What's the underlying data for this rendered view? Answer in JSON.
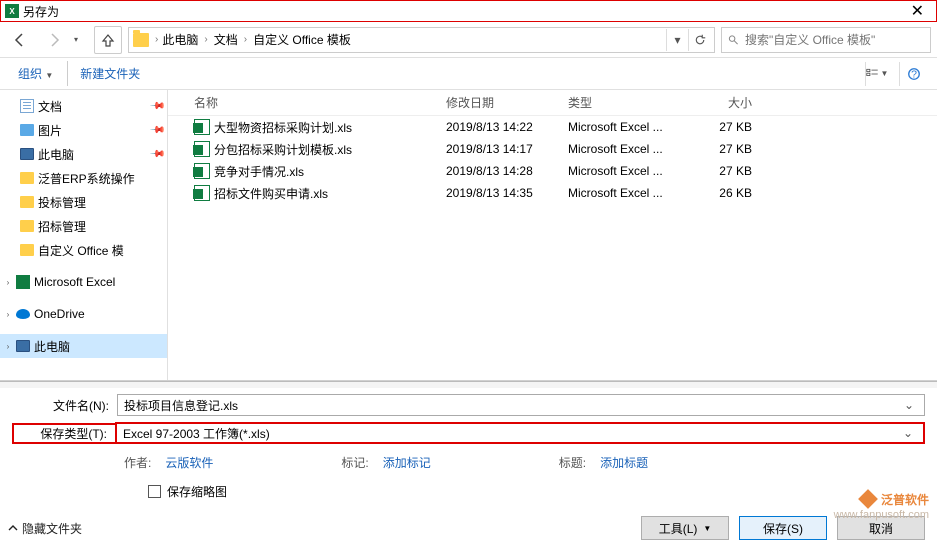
{
  "window": {
    "title": "另存为"
  },
  "nav": {
    "crumbs": [
      "此电脑",
      "文档",
      "自定义 Office 模板"
    ],
    "search_placeholder": "搜索\"自定义 Office 模板\""
  },
  "toolbar": {
    "organize": "组织",
    "new_folder": "新建文件夹"
  },
  "sidebar": {
    "items": [
      {
        "label": "文档",
        "icon": "doc",
        "pinned": true
      },
      {
        "label": "图片",
        "icon": "pic",
        "pinned": true
      },
      {
        "label": "此电脑",
        "icon": "pc",
        "pinned": true
      },
      {
        "label": "泛普ERP系统操作",
        "icon": "fold"
      },
      {
        "label": "投标管理",
        "icon": "fold"
      },
      {
        "label": "招标管理",
        "icon": "fold"
      },
      {
        "label": "自定义 Office 模",
        "icon": "fold"
      }
    ],
    "excel": "Microsoft Excel",
    "onedrive": "OneDrive",
    "this_pc": "此电脑"
  },
  "columns": {
    "name": "名称",
    "date": "修改日期",
    "type": "类型",
    "size": "大小"
  },
  "files": [
    {
      "name": "大型物资招标采购计划.xls",
      "date": "2019/8/13 14:22",
      "type": "Microsoft Excel ...",
      "size": "27 KB"
    },
    {
      "name": "分包招标采购计划模板.xls",
      "date": "2019/8/13 14:17",
      "type": "Microsoft Excel ...",
      "size": "27 KB"
    },
    {
      "name": "竞争对手情况.xls",
      "date": "2019/8/13 14:28",
      "type": "Microsoft Excel ...",
      "size": "27 KB"
    },
    {
      "name": "招标文件购买申请.xls",
      "date": "2019/8/13 14:35",
      "type": "Microsoft Excel ...",
      "size": "26 KB"
    }
  ],
  "form": {
    "filename_label": "文件名(N):",
    "filename_value": "投标项目信息登记.xls",
    "filetype_label": "保存类型(T):",
    "filetype_value": "Excel 97-2003 工作簿(*.xls)",
    "author_label": "作者:",
    "author_value": "云版软件",
    "tag_label": "标记:",
    "tag_value": "添加标记",
    "title_label": "标题:",
    "title_value": "添加标题",
    "thumbnail": "保存缩略图"
  },
  "buttons": {
    "hide_folders": "隐藏文件夹",
    "tools": "工具(L)",
    "save": "保存(S)",
    "cancel": "取消"
  },
  "watermark": {
    "line1": "泛普软件",
    "line2": "www.fanpusoft.com"
  }
}
